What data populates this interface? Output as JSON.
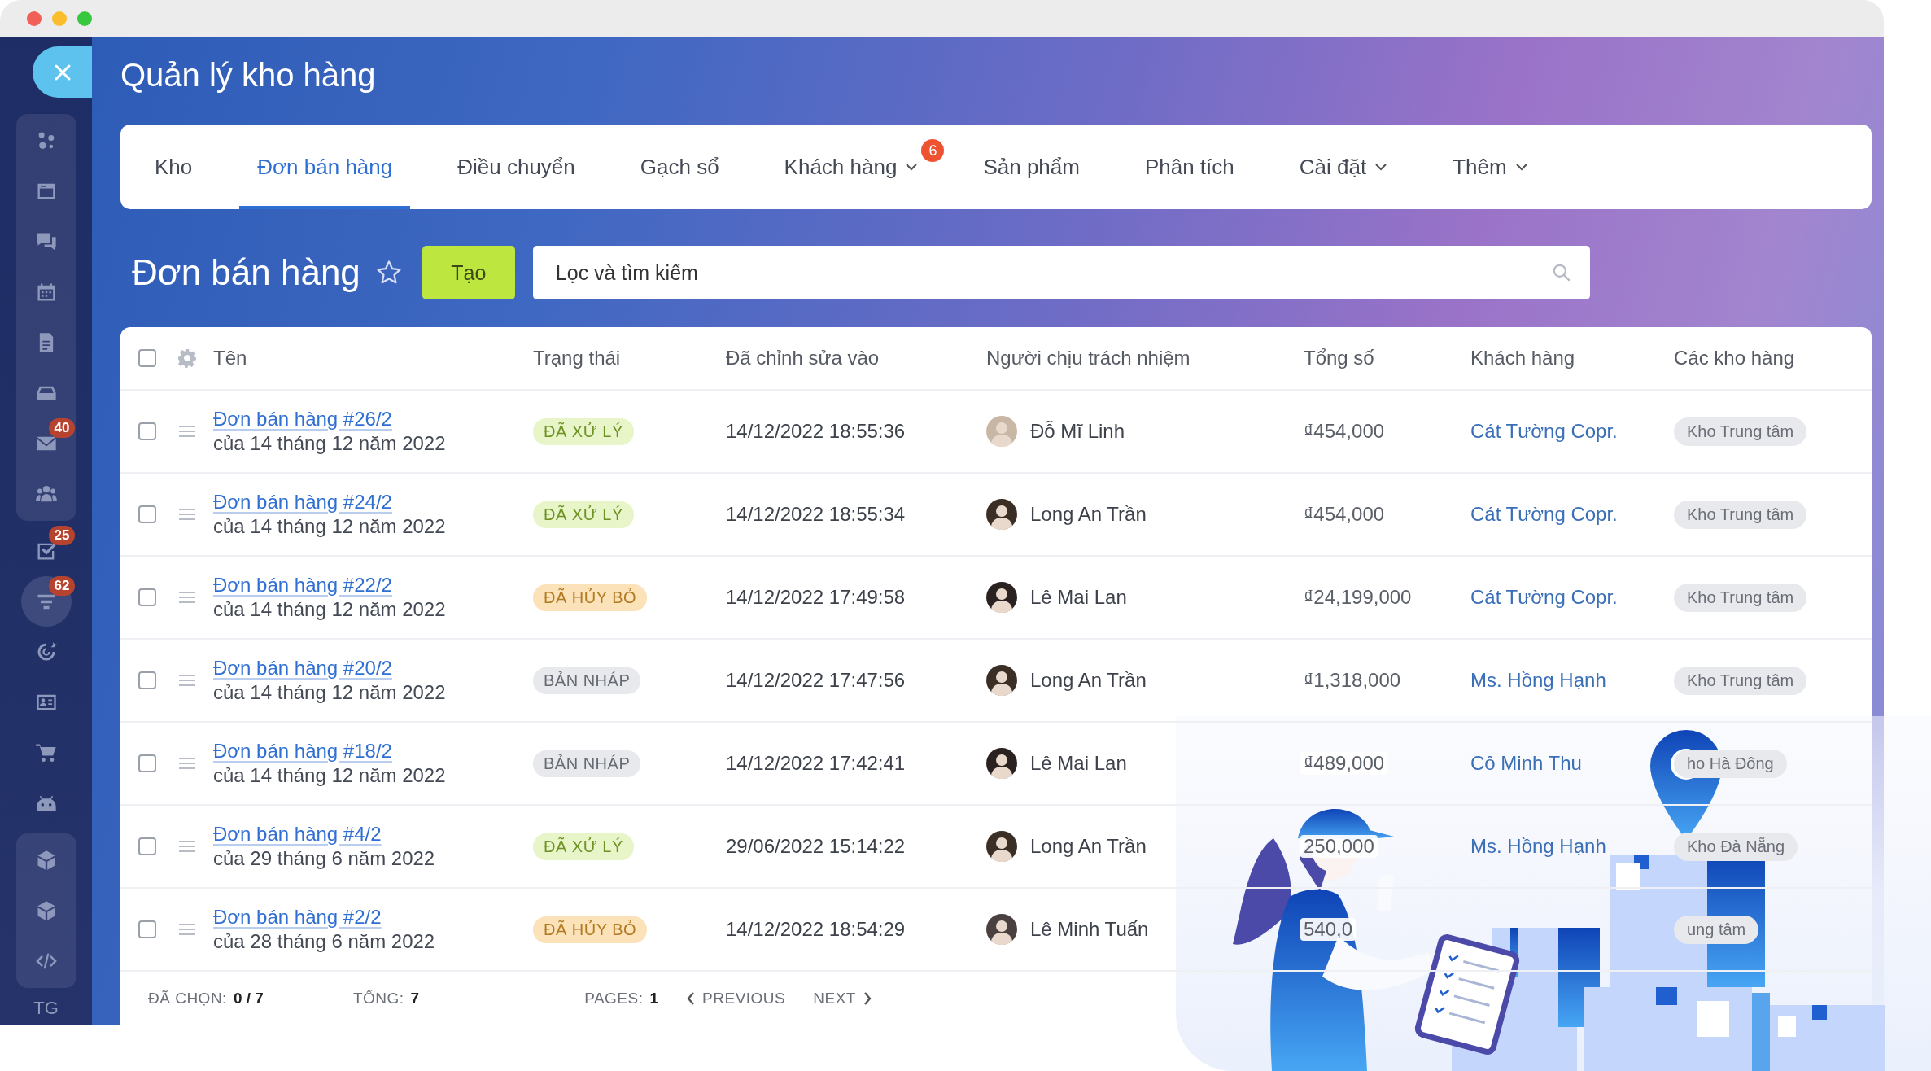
{
  "window": {
    "title": "Quản lý kho hàng"
  },
  "sidebar": {
    "sections": [
      {
        "boxed": true,
        "items": [
          {
            "selected": false
          },
          {
            "selected": false
          },
          {
            "selected": false
          },
          {
            "selected": false
          },
          {
            "selected": false
          },
          {
            "selected": false
          },
          {
            "selected": false,
            "badge": "40"
          },
          {
            "selected": false
          }
        ]
      },
      {
        "boxed": false,
        "items": [
          {
            "selected": false,
            "badge": "25"
          },
          {
            "selected": true,
            "badge": "62"
          },
          {
            "selected": false
          },
          {
            "selected": false
          },
          {
            "selected": false
          },
          {
            "selected": false
          }
        ]
      },
      {
        "boxed": true,
        "items": [
          {
            "selected": false
          },
          {
            "selected": false
          },
          {
            "selected": false
          }
        ]
      }
    ],
    "user_initials": "TG"
  },
  "tabs": [
    {
      "label": "Kho",
      "selected": false,
      "has_menu": false
    },
    {
      "label": "Đơn bán hàng",
      "selected": true,
      "has_menu": false
    },
    {
      "label": "Điều chuyển",
      "selected": false,
      "has_menu": false
    },
    {
      "label": "Gạch sổ",
      "selected": false,
      "has_menu": false
    },
    {
      "label": "Khách hàng",
      "selected": false,
      "has_menu": true,
      "badge": "6"
    },
    {
      "label": "Sản phẩm",
      "selected": false,
      "has_menu": false
    },
    {
      "label": "Phân tích",
      "selected": false,
      "has_menu": false
    },
    {
      "label": "Cài đặt",
      "selected": false,
      "has_menu": true
    },
    {
      "label": "Thêm",
      "selected": false,
      "has_menu": true
    }
  ],
  "page": {
    "title": "Đơn bán hàng",
    "favorite": false,
    "create_button": "Tạo",
    "search": {
      "placeholder": "Lọc và tìm kiếm"
    }
  },
  "table": {
    "all_checked": false,
    "columns": [
      "Tên",
      "Trạng thái",
      "Đã chỉnh sửa vào",
      "Người chịu trách nhiệm",
      "Tổng số",
      "Khách hàng",
      "Các kho hàng"
    ],
    "rows": [
      {
        "checked": false,
        "name": "Đơn bán hàng #26/2",
        "date": "của 14 tháng 12 năm 2022",
        "status": {
          "kind": "done",
          "label": "ĐÃ XỬ LÝ"
        },
        "edited": "14/12/2022 18:55:36",
        "person": "Đỗ Mĩ Linh",
        "total": "₫454,000",
        "customer": "Cát Tường Copr.",
        "warehouse": "Kho Trung tâm"
      },
      {
        "checked": false,
        "name": "Đơn bán hàng #24/2",
        "date": "của 14 tháng 12 năm 2022",
        "status": {
          "kind": "done",
          "label": "ĐÃ XỬ LÝ"
        },
        "edited": "14/12/2022 18:55:34",
        "person": "Long An Trần",
        "total": "₫454,000",
        "customer": "Cát Tường Copr.",
        "warehouse": "Kho Trung tâm"
      },
      {
        "checked": false,
        "name": "Đơn bán hàng #22/2",
        "date": "của 14 tháng 12 năm 2022",
        "status": {
          "kind": "cancelled",
          "label": "ĐÃ HỦY BỎ"
        },
        "edited": "14/12/2022 17:49:58",
        "person": "Lê Mai Lan",
        "total": "₫24,199,000",
        "customer": "Cát Tường Copr.",
        "warehouse": "Kho Trung tâm"
      },
      {
        "checked": false,
        "name": "Đơn bán hàng #20/2",
        "date": "của 14 tháng 12 năm 2022",
        "status": {
          "kind": "draft",
          "label": "BẢN NHÁP"
        },
        "edited": "14/12/2022 17:47:56",
        "person": "Long An Trần",
        "total": "₫1,318,000",
        "customer": "Ms. Hồng Hạnh",
        "warehouse": "Kho Trung tâm"
      },
      {
        "checked": false,
        "name": "Đơn bán hàng #18/2",
        "date": "của 14 tháng 12 năm 2022",
        "status": {
          "kind": "draft",
          "label": "BẢN NHÁP"
        },
        "edited": "14/12/2022 17:42:41",
        "person": "Lê Mai Lan",
        "total": "₫489,000",
        "customer": "Cô Minh Thu",
        "warehouse": "ho Hà Đông"
      },
      {
        "checked": false,
        "name": "Đơn bán hàng #4/2",
        "date": "của 29 tháng 6 năm 2022",
        "status": {
          "kind": "done",
          "label": "ĐÃ XỬ LÝ"
        },
        "edited": "29/06/2022 15:14:22",
        "person": "Long An Trần",
        "total": "250,000",
        "customer": "Ms. Hồng Hạnh",
        "warehouse": "Kho Đà Nẵng"
      },
      {
        "checked": false,
        "name": "Đơn bán hàng #2/2",
        "date": "của 28 tháng 6 năm 2022",
        "status": {
          "kind": "cancelled",
          "label": "ĐÃ HỦY BỎ"
        },
        "edited": "14/12/2022 18:54:29",
        "person": "Lê Minh Tuấn",
        "total": "540,0",
        "warehouse": "ung tâm"
      }
    ]
  },
  "footer": {
    "selected_label": "ĐÃ CHỌN:",
    "selected_value": "0 / 7",
    "total_label": "TỔNG:",
    "total_value": "7",
    "pages_label": "PAGES:",
    "pages_value": "1",
    "previous": "PREVIOUS",
    "next": "NEXT"
  }
}
